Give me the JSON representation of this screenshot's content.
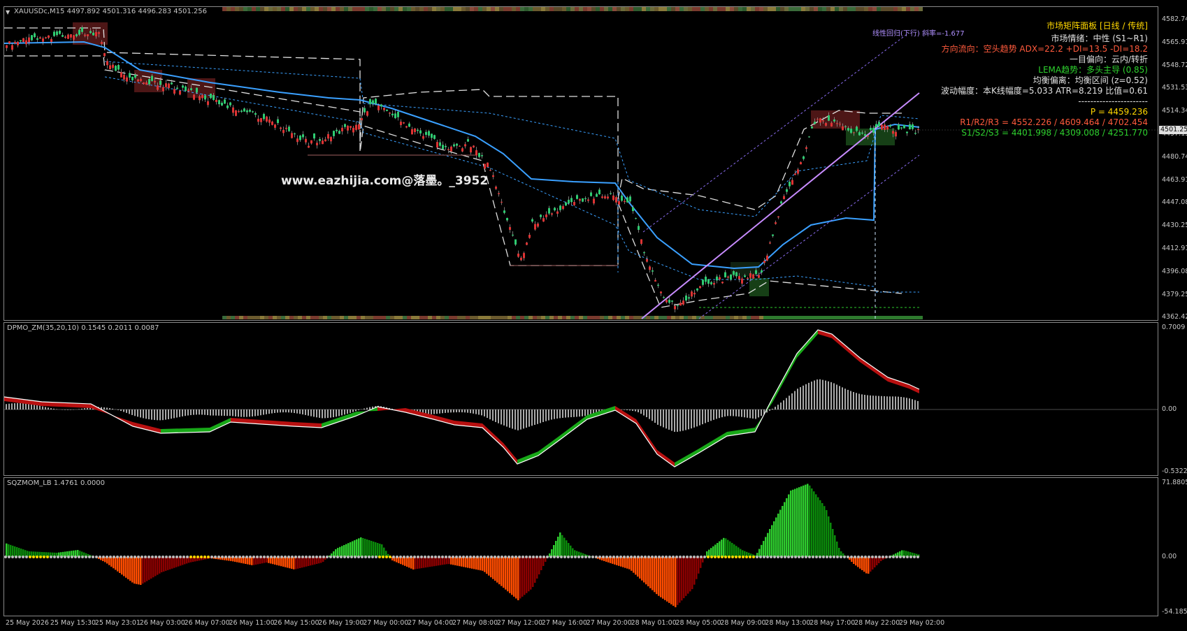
{
  "main": {
    "symbol_label": "XAUUSDc,M15  4497.892 4501.316 4496.283 4501.256",
    "price_ticks": [
      "4582.740",
      "4565.910",
      "4548.720",
      "4531.530",
      "4514.340",
      "4497.150",
      "4480.740",
      "4463.910",
      "4447.080",
      "4430.250",
      "4412.910",
      "4396.080",
      "4379.250",
      "4362.420"
    ],
    "current_price": "4501.256",
    "watermark": "www.eazhijia.com@落墨。_3952",
    "regression_label": "线性回归(下行) 斜率=-1.677"
  },
  "panel_info": {
    "title": "市场矩阵面板   [日线 / 传统]",
    "rows": [
      {
        "text": "市场情绪：中性 (S1~R1)",
        "color": "#e0e0e0"
      },
      {
        "text": "方向流向：空头趋势  ADX=22.2  +DI=13.5  -DI=18.2",
        "color": "#ff5a3c"
      },
      {
        "text": "一目偏向：云内/转折",
        "color": "#e0e0e0"
      },
      {
        "text": "LEMA趋势：多头主导 (0.85)",
        "color": "#2ed12e"
      },
      {
        "text": "均衡偏离：均衡区间 (z=0.52)",
        "color": "#e0e0e0"
      },
      {
        "text": "波动幅度：本K线幅度=5.033  ATR=8.219  比值=0.61",
        "color": "#e0e0e0"
      },
      {
        "text": "-----------------------",
        "color": "#e0e0e0"
      },
      {
        "text": "P  = 4459.236",
        "color": "#ffd700"
      },
      {
        "text": "R1/R2/R3 = 4552.226 / 4609.464 / 4702.454",
        "color": "#ff5a3c"
      },
      {
        "text": "S1/S2/S3 = 4401.998 / 4309.008 / 4251.770",
        "color": "#2ed12e"
      }
    ],
    "title_color": "#ffd700"
  },
  "dpmo": {
    "label": "DPMO_ZM(35,20,10) 0.1545 0.2011 0.0087",
    "ticks": [
      "0.7009",
      "0.00",
      "-0.5322"
    ]
  },
  "sqz": {
    "label": "SQZMOM_LB 1.4761 0.0000",
    "ticks": [
      "71.8805",
      "0.00",
      "-54.1855"
    ]
  },
  "time_ticks": [
    "25 May 2026",
    "25 May 15:30",
    "25 May 23:01",
    "26 May 03:00",
    "26 May 07:00",
    "26 May 11:00",
    "26 May 15:00",
    "26 May 19:00",
    "27 May 00:00",
    "27 May 04:00",
    "27 May 08:00",
    "27 May 12:00",
    "27 May 16:00",
    "27 May 20:00",
    "28 May 01:00",
    "28 May 05:00",
    "28 May 09:00",
    "28 May 13:00",
    "28 May 17:00",
    "28 May 22:00",
    "29 May 02:00"
  ],
  "colors": {
    "bull": "#1fa51f",
    "bear": "#a51010",
    "ma_blue": "#3aa0ff",
    "regression": "#c88cff",
    "sqz_lime": "#2ecc2e",
    "sqz_green": "#0b8a0b",
    "sqz_orange": "#ff4c00",
    "sqz_maroon": "#8b0000"
  }
}
